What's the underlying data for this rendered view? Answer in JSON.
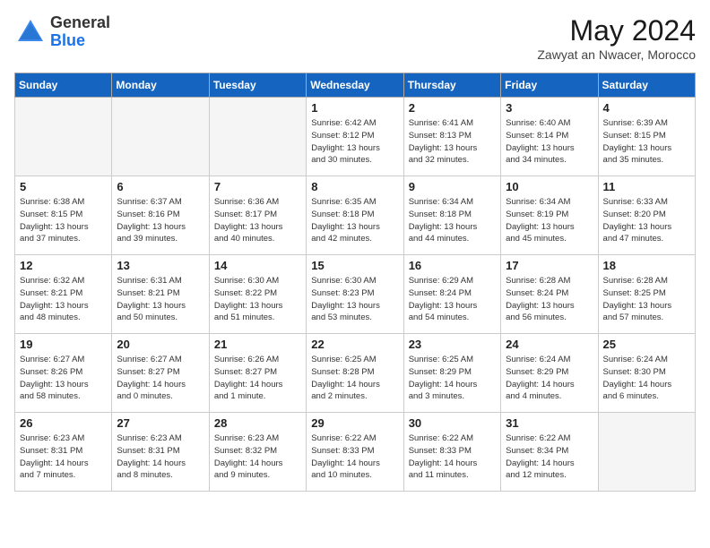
{
  "header": {
    "logo_general": "General",
    "logo_blue": "Blue",
    "month_title": "May 2024",
    "subtitle": "Zawyat an Nwacer, Morocco"
  },
  "days_of_week": [
    "Sunday",
    "Monday",
    "Tuesday",
    "Wednesday",
    "Thursday",
    "Friday",
    "Saturday"
  ],
  "weeks": [
    [
      {
        "day": "",
        "info": ""
      },
      {
        "day": "",
        "info": ""
      },
      {
        "day": "",
        "info": ""
      },
      {
        "day": "1",
        "info": "Sunrise: 6:42 AM\nSunset: 8:12 PM\nDaylight: 13 hours\nand 30 minutes."
      },
      {
        "day": "2",
        "info": "Sunrise: 6:41 AM\nSunset: 8:13 PM\nDaylight: 13 hours\nand 32 minutes."
      },
      {
        "day": "3",
        "info": "Sunrise: 6:40 AM\nSunset: 8:14 PM\nDaylight: 13 hours\nand 34 minutes."
      },
      {
        "day": "4",
        "info": "Sunrise: 6:39 AM\nSunset: 8:15 PM\nDaylight: 13 hours\nand 35 minutes."
      }
    ],
    [
      {
        "day": "5",
        "info": "Sunrise: 6:38 AM\nSunset: 8:15 PM\nDaylight: 13 hours\nand 37 minutes."
      },
      {
        "day": "6",
        "info": "Sunrise: 6:37 AM\nSunset: 8:16 PM\nDaylight: 13 hours\nand 39 minutes."
      },
      {
        "day": "7",
        "info": "Sunrise: 6:36 AM\nSunset: 8:17 PM\nDaylight: 13 hours\nand 40 minutes."
      },
      {
        "day": "8",
        "info": "Sunrise: 6:35 AM\nSunset: 8:18 PM\nDaylight: 13 hours\nand 42 minutes."
      },
      {
        "day": "9",
        "info": "Sunrise: 6:34 AM\nSunset: 8:18 PM\nDaylight: 13 hours\nand 44 minutes."
      },
      {
        "day": "10",
        "info": "Sunrise: 6:34 AM\nSunset: 8:19 PM\nDaylight: 13 hours\nand 45 minutes."
      },
      {
        "day": "11",
        "info": "Sunrise: 6:33 AM\nSunset: 8:20 PM\nDaylight: 13 hours\nand 47 minutes."
      }
    ],
    [
      {
        "day": "12",
        "info": "Sunrise: 6:32 AM\nSunset: 8:21 PM\nDaylight: 13 hours\nand 48 minutes."
      },
      {
        "day": "13",
        "info": "Sunrise: 6:31 AM\nSunset: 8:21 PM\nDaylight: 13 hours\nand 50 minutes."
      },
      {
        "day": "14",
        "info": "Sunrise: 6:30 AM\nSunset: 8:22 PM\nDaylight: 13 hours\nand 51 minutes."
      },
      {
        "day": "15",
        "info": "Sunrise: 6:30 AM\nSunset: 8:23 PM\nDaylight: 13 hours\nand 53 minutes."
      },
      {
        "day": "16",
        "info": "Sunrise: 6:29 AM\nSunset: 8:24 PM\nDaylight: 13 hours\nand 54 minutes."
      },
      {
        "day": "17",
        "info": "Sunrise: 6:28 AM\nSunset: 8:24 PM\nDaylight: 13 hours\nand 56 minutes."
      },
      {
        "day": "18",
        "info": "Sunrise: 6:28 AM\nSunset: 8:25 PM\nDaylight: 13 hours\nand 57 minutes."
      }
    ],
    [
      {
        "day": "19",
        "info": "Sunrise: 6:27 AM\nSunset: 8:26 PM\nDaylight: 13 hours\nand 58 minutes."
      },
      {
        "day": "20",
        "info": "Sunrise: 6:27 AM\nSunset: 8:27 PM\nDaylight: 14 hours\nand 0 minutes."
      },
      {
        "day": "21",
        "info": "Sunrise: 6:26 AM\nSunset: 8:27 PM\nDaylight: 14 hours\nand 1 minute."
      },
      {
        "day": "22",
        "info": "Sunrise: 6:25 AM\nSunset: 8:28 PM\nDaylight: 14 hours\nand 2 minutes."
      },
      {
        "day": "23",
        "info": "Sunrise: 6:25 AM\nSunset: 8:29 PM\nDaylight: 14 hours\nand 3 minutes."
      },
      {
        "day": "24",
        "info": "Sunrise: 6:24 AM\nSunset: 8:29 PM\nDaylight: 14 hours\nand 4 minutes."
      },
      {
        "day": "25",
        "info": "Sunrise: 6:24 AM\nSunset: 8:30 PM\nDaylight: 14 hours\nand 6 minutes."
      }
    ],
    [
      {
        "day": "26",
        "info": "Sunrise: 6:23 AM\nSunset: 8:31 PM\nDaylight: 14 hours\nand 7 minutes."
      },
      {
        "day": "27",
        "info": "Sunrise: 6:23 AM\nSunset: 8:31 PM\nDaylight: 14 hours\nand 8 minutes."
      },
      {
        "day": "28",
        "info": "Sunrise: 6:23 AM\nSunset: 8:32 PM\nDaylight: 14 hours\nand 9 minutes."
      },
      {
        "day": "29",
        "info": "Sunrise: 6:22 AM\nSunset: 8:33 PM\nDaylight: 14 hours\nand 10 minutes."
      },
      {
        "day": "30",
        "info": "Sunrise: 6:22 AM\nSunset: 8:33 PM\nDaylight: 14 hours\nand 11 minutes."
      },
      {
        "day": "31",
        "info": "Sunrise: 6:22 AM\nSunset: 8:34 PM\nDaylight: 14 hours\nand 12 minutes."
      },
      {
        "day": "",
        "info": ""
      }
    ]
  ]
}
